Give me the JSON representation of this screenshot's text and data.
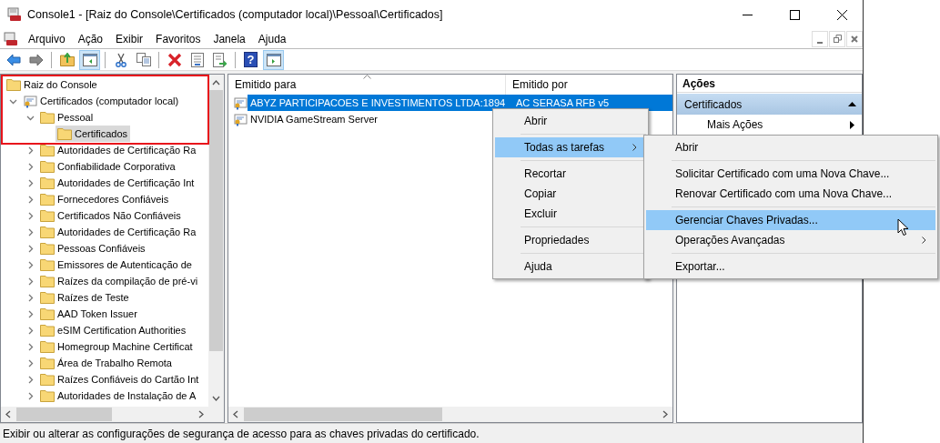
{
  "window": {
    "title": "Console1 - [Raiz do Console\\Certificados (computador local)\\Pessoal\\Certificados]"
  },
  "menu_bar": [
    "Arquivo",
    "Ação",
    "Exibir",
    "Favoritos",
    "Janela",
    "Ajuda"
  ],
  "toolbar": [
    {
      "kind": "back",
      "selected": false
    },
    {
      "kind": "forward",
      "selected": false
    },
    {
      "kind": "separator"
    },
    {
      "kind": "up",
      "selected": false
    },
    {
      "kind": "tree-toggle",
      "selected": true
    },
    {
      "kind": "separator"
    },
    {
      "kind": "cut",
      "selected": false
    },
    {
      "kind": "copy",
      "selected": false
    },
    {
      "kind": "separator"
    },
    {
      "kind": "delete",
      "selected": false
    },
    {
      "kind": "properties",
      "selected": false
    },
    {
      "kind": "export",
      "selected": false
    },
    {
      "kind": "separator"
    },
    {
      "kind": "help",
      "glyph": "?",
      "selected": false
    },
    {
      "kind": "pane-toggle",
      "selected": true
    }
  ],
  "tree": [
    {
      "label": "Raiz do Console",
      "kind": "folder",
      "selected": false,
      "children": [
        {
          "label": "Certificados (computador local)",
          "kind": "store",
          "expanded": true,
          "selected": false,
          "children": [
            {
              "label": "Pessoal",
              "kind": "folder",
              "expanded": true,
              "selected": false,
              "children": [
                {
                  "label": "Certificados",
                  "kind": "folder",
                  "selected": true
                }
              ]
            },
            {
              "label": "Autoridades de Certificação Ra",
              "kind": "folder",
              "expanded": false,
              "selected": false
            },
            {
              "label": "Confiabilidade Corporativa",
              "kind": "folder",
              "expanded": false,
              "selected": false
            },
            {
              "label": "Autoridades de Certificação Int",
              "kind": "folder",
              "expanded": false,
              "selected": false
            },
            {
              "label": "Fornecedores Confiáveis",
              "kind": "folder",
              "expanded": false,
              "selected": false
            },
            {
              "label": "Certificados Não Confiáveis",
              "kind": "folder",
              "expanded": false,
              "selected": false
            },
            {
              "label": "Autoridades de Certificação Ra",
              "kind": "folder",
              "expanded": false,
              "selected": false
            },
            {
              "label": "Pessoas Confiáveis",
              "kind": "folder",
              "expanded": false,
              "selected": false
            },
            {
              "label": "Emissores de Autenticação de",
              "kind": "folder",
              "expanded": false,
              "selected": false
            },
            {
              "label": "Raízes da compilação de pré-vi",
              "kind": "folder",
              "expanded": false,
              "selected": false
            },
            {
              "label": "Raízes de Teste",
              "kind": "folder",
              "expanded": false,
              "selected": false
            },
            {
              "label": "AAD Token Issuer",
              "kind": "folder",
              "expanded": false,
              "selected": false
            },
            {
              "label": "eSIM Certification Authorities",
              "kind": "folder",
              "expanded": false,
              "selected": false
            },
            {
              "label": "Homegroup Machine Certificat",
              "kind": "folder",
              "expanded": false,
              "selected": false
            },
            {
              "label": "Área de Trabalho Remota",
              "kind": "folder",
              "expanded": false,
              "selected": false
            },
            {
              "label": "Raízes Confiáveis do Cartão Int",
              "kind": "folder",
              "expanded": false,
              "selected": false
            },
            {
              "label": "Autoridades de Instalação de A",
              "kind": "folder",
              "expanded": false,
              "selected": false
            }
          ]
        }
      ]
    }
  ],
  "list": {
    "columns": [
      {
        "label": "Emitido para",
        "sorted": true
      },
      {
        "label": "Emitido por",
        "sorted": false
      }
    ],
    "rows": [
      {
        "cells": [
          "ABYZ PARTICIPACOES E INVESTIMENTOS LTDA:1894",
          "AC SERASA RFB v5"
        ],
        "selected": true
      },
      {
        "cells": [
          "NVIDIA GameStream Server"
        ],
        "selected": false
      }
    ]
  },
  "actions": {
    "title": "Ações",
    "section": {
      "label": "Certificados",
      "expanded": true
    },
    "items": [
      {
        "label": "Mais Ações",
        "submenu": true
      }
    ]
  },
  "context_menu": [
    {
      "kind": "item",
      "label": "Abrir",
      "selected": false,
      "submenu": false
    },
    {
      "kind": "separator"
    },
    {
      "kind": "item",
      "label": "Todas as tarefas",
      "selected": true,
      "submenu": true
    },
    {
      "kind": "separator"
    },
    {
      "kind": "item",
      "label": "Recortar",
      "selected": false,
      "submenu": false
    },
    {
      "kind": "item",
      "label": "Copiar",
      "selected": false,
      "submenu": false
    },
    {
      "kind": "item",
      "label": "Excluir",
      "selected": false,
      "submenu": false
    },
    {
      "kind": "separator"
    },
    {
      "kind": "item",
      "label": "Propriedades",
      "selected": false,
      "submenu": false
    },
    {
      "kind": "separator"
    },
    {
      "kind": "item",
      "label": "Ajuda",
      "selected": false,
      "submenu": false
    }
  ],
  "submenu": [
    {
      "kind": "item",
      "label": "Abrir",
      "selected": false,
      "submenu": false
    },
    {
      "kind": "separator"
    },
    {
      "kind": "item",
      "label": "Solicitar Certificado com uma Nova Chave...",
      "selected": false,
      "submenu": false
    },
    {
      "kind": "item",
      "label": "Renovar Certificado com uma Nova Chave...",
      "selected": false,
      "submenu": false
    },
    {
      "kind": "separator"
    },
    {
      "kind": "item",
      "label": "Gerenciar Chaves Privadas...",
      "selected": true,
      "submenu": false
    },
    {
      "kind": "item",
      "label": "Operações Avançadas",
      "selected": false,
      "submenu": true
    },
    {
      "kind": "separator"
    },
    {
      "kind": "item",
      "label": "Exportar...",
      "selected": false,
      "submenu": false
    }
  ],
  "status_bar": "Exibir ou alterar as configurações de segurança de acesso para as chaves privadas do certificado."
}
